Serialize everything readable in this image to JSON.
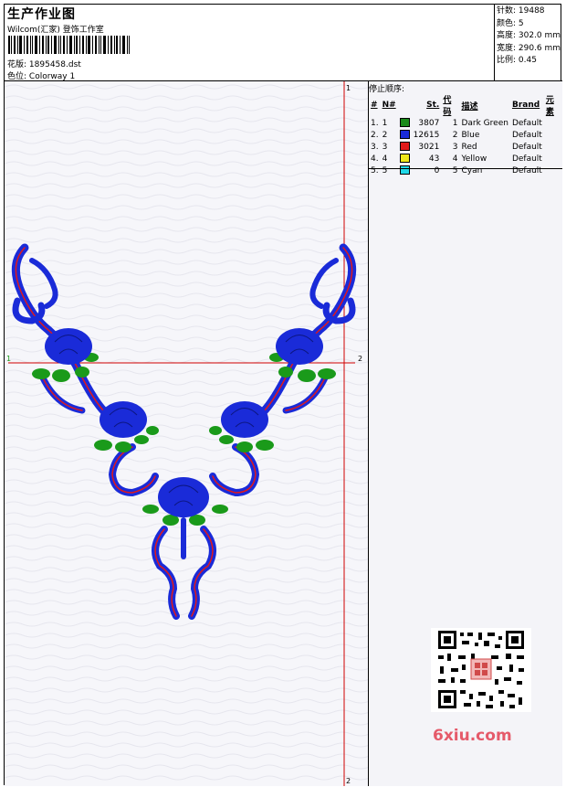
{
  "header": {
    "title": "生产作业图",
    "studio": "Wilcom(汇家) 登饰工作室",
    "design_label": "花版:",
    "design_file": "1895458.dst",
    "colorway_label": "色位:",
    "colorway": "Colorway 1"
  },
  "stats": {
    "stitches": "针数: 19488",
    "colors": "颜色: 5",
    "height": "高度: 302.0 mm",
    "width": "宽度: 290.6 mm",
    "scale": "比例: 0.45"
  },
  "stop_sequence": {
    "title": "停止顺序:",
    "columns": [
      "#",
      "N#",
      "St.",
      "代码",
      "描述",
      "Brand",
      "元素"
    ],
    "rows": [
      {
        "idx": "1.",
        "n": "1",
        "color": "#1a8a1a",
        "st": "3807",
        "code": "1",
        "desc": "Dark Green",
        "brand": "Default"
      },
      {
        "idx": "2.",
        "n": "2",
        "color": "#1a2bd8",
        "st": "12615",
        "code": "2",
        "desc": "Blue",
        "brand": "Default"
      },
      {
        "idx": "3.",
        "n": "3",
        "color": "#e01a1a",
        "st": "3021",
        "code": "3",
        "desc": "Red",
        "brand": "Default"
      },
      {
        "idx": "4.",
        "n": "4",
        "color": "#f0e81a",
        "st": "43",
        "code": "4",
        "desc": "Yellow",
        "brand": "Default"
      },
      {
        "idx": "5.",
        "n": "5",
        "color": "#20d8e8",
        "st": "0",
        "code": "5",
        "desc": "Cyan",
        "brand": "Default"
      }
    ]
  },
  "canvas": {
    "guide_labels": {
      "top": "1",
      "bottom": "2",
      "left": "1",
      "right": "2"
    }
  },
  "watermark": "6xiu.com",
  "palette": {
    "guide": "#d00000",
    "blue": "#1a2bd8",
    "green": "#1a9a1a",
    "red": "#e01a1a"
  }
}
